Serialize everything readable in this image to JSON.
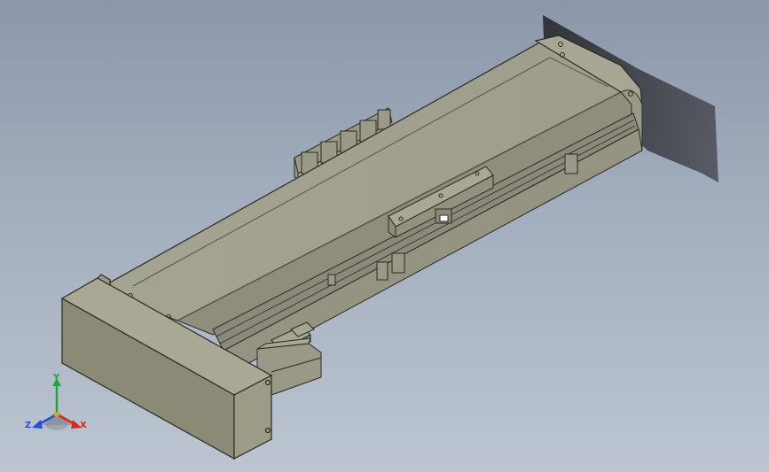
{
  "viewport": {
    "background_top": "#8c98aa",
    "background_bottom": "#bcc5d1",
    "model_color": "#a2a18f",
    "model_edge_color": "#2a2a22"
  },
  "triad": {
    "x_label": "X",
    "y_label": "Y",
    "z_label": "Z",
    "x_color": "#d8281e",
    "y_color": "#1fa83a",
    "z_color": "#2a4fd6"
  }
}
